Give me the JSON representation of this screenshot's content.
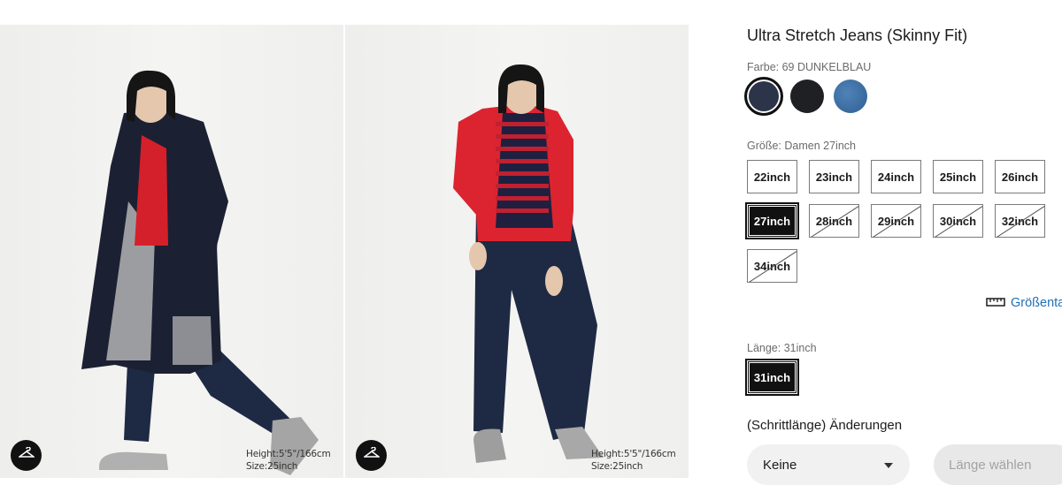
{
  "product": {
    "title": "Ultra Stretch Jeans (Skinny Fit)"
  },
  "color": {
    "label": "Farbe: 69 DUNKELBLAU",
    "swatches": [
      {
        "name": "69 DUNKELBLAU",
        "hex": "#2b3448",
        "selected": true
      },
      {
        "name": "black",
        "hex": "#1f2024",
        "selected": false
      },
      {
        "name": "blue",
        "hex": "#3b6ea3",
        "selected": false
      }
    ]
  },
  "size": {
    "label": "Größe: Damen 27inch",
    "options": [
      {
        "label": "22inch",
        "available": true,
        "selected": false
      },
      {
        "label": "23inch",
        "available": true,
        "selected": false
      },
      {
        "label": "24inch",
        "available": true,
        "selected": false
      },
      {
        "label": "25inch",
        "available": true,
        "selected": false
      },
      {
        "label": "26inch",
        "available": true,
        "selected": false
      },
      {
        "label": "27inch",
        "available": true,
        "selected": true
      },
      {
        "label": "28inch",
        "available": false,
        "selected": false
      },
      {
        "label": "29inch",
        "available": false,
        "selected": false
      },
      {
        "label": "30inch",
        "available": false,
        "selected": false
      },
      {
        "label": "32inch",
        "available": false,
        "selected": false
      },
      {
        "label": "34inch",
        "available": false,
        "selected": false
      }
    ],
    "guide_label": "Größentabelle"
  },
  "length": {
    "label": "Länge: 31inch",
    "options": [
      {
        "label": "31inch",
        "available": true,
        "selected": true
      }
    ]
  },
  "alterations": {
    "label": "(Schrittlänge) Änderungen",
    "select_value": "Keine",
    "length_button": "Länge wählen"
  },
  "photos": [
    {
      "height": "Height:5'5\"/166cm",
      "size": "Size:25inch",
      "icon": "hanger-icon"
    },
    {
      "height": "Height:5'5\"/166cm",
      "size": "Size:25inch",
      "icon": "hanger-icon"
    }
  ],
  "colors": {
    "accent": "#111111",
    "link": "#1f6fb5",
    "muted": "#6b6b6b"
  }
}
